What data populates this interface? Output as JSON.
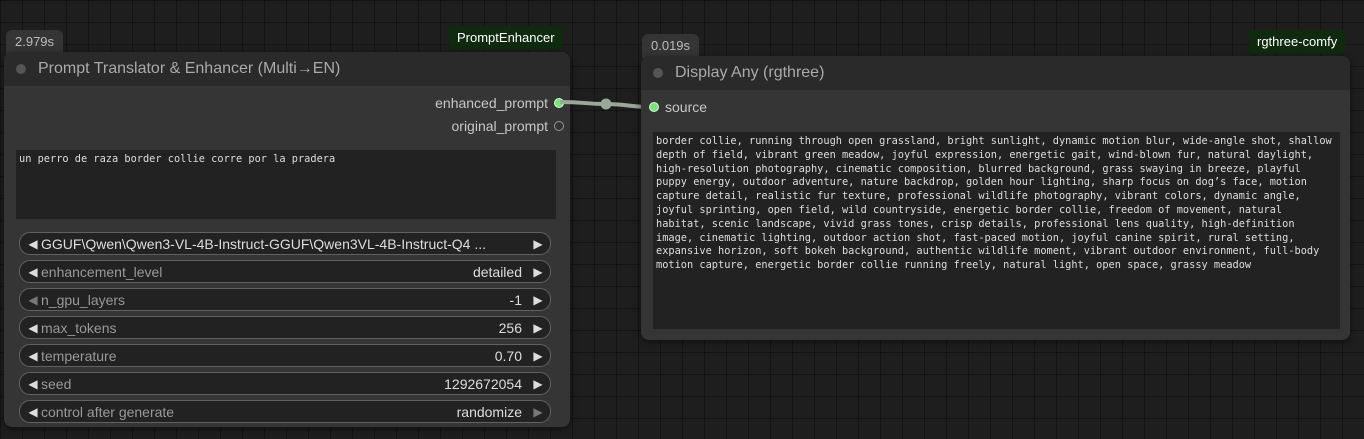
{
  "node1": {
    "time_badge": "2.979s",
    "tag": "PromptEnhancer",
    "title": "Prompt Translator & Enhancer (Multi→EN)",
    "outputs": [
      "enhanced_prompt",
      "original_prompt"
    ],
    "prompt_text": "un perro de raza border collie corre por la pradera",
    "model": "GGUF\\Qwen\\Qwen3-VL-4B-Instruct-GGUF\\Qwen3VL-4B-Instruct-Q4 ...",
    "widgets": [
      {
        "label": "enhancement_level",
        "value": "detailed"
      },
      {
        "label": "n_gpu_layers",
        "value": "-1"
      },
      {
        "label": "max_tokens",
        "value": "256"
      },
      {
        "label": "temperature",
        "value": "0.70"
      },
      {
        "label": "seed",
        "value": "1292672054"
      },
      {
        "label": "control after generate",
        "value": "randomize"
      }
    ]
  },
  "node2": {
    "time_badge": "0.019s",
    "tag": "rgthree-comfy",
    "title": "Display Any (rgthree)",
    "input": "source",
    "output_text": "border collie, running through open grassland, bright sunlight, dynamic motion blur, wide-angle shot, shallow depth of field, vibrant green meadow, joyful expression, energetic gait, wind-blown fur, natural daylight, high-resolution photography, cinematic composition, blurred background, grass swaying in breeze, playful puppy energy, outdoor adventure, nature backdrop, golden hour lighting, sharp focus on dog’s face, motion capture detail, realistic fur texture, professional wildlife photography, vibrant colors, dynamic angle, joyful sprinting, open field, wild countryside, energetic border collie, freedom of movement, natural habitat, scenic landscape, vivid grass tones, crisp details, professional lens quality, high-definition image, cinematic lighting, outdoor action shot, fast-paced motion, joyful canine spirit, rural setting, expansive horizon, soft bokeh background, authentic wildlife moment, vibrant outdoor environment, full-body motion capture, energetic border collie running freely, natural light, open space, grassy meadow"
  },
  "colors": {
    "canvas": "#1e1e1e",
    "node_body": "#353535",
    "node_title": "#2a2a2a",
    "link": "#9aa89a",
    "slot_green": "#7fe07f",
    "tag_bg": "#0f2a0f"
  }
}
